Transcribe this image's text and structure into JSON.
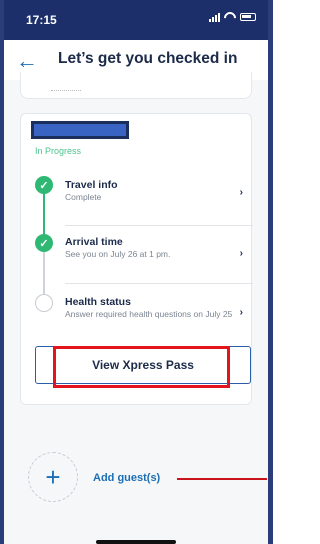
{
  "status_bar": {
    "time": "17:15"
  },
  "header": {
    "title": "Let’s get you checked in"
  },
  "checkin": {
    "status": "In Progress",
    "steps": [
      {
        "title": "Travel info",
        "subtitle": "Complete",
        "state": "complete"
      },
      {
        "title": "Arrival time",
        "subtitle": "See you on July 26 at 1 pm.",
        "state": "complete"
      },
      {
        "title": "Health status",
        "subtitle": "Answer required health questions on July 25",
        "state": "pending"
      }
    ],
    "xpress_button_label": "View Xpress Pass"
  },
  "guests": {
    "add_label": "Add guest(s)"
  },
  "colors": {
    "accent": "#1c6fb5",
    "complete": "#2eb873",
    "annotation": "#e3141b",
    "statusbar": "#1c2f6b"
  },
  "icons": {
    "back": "back-arrow-icon",
    "check": "checkmark-icon",
    "chevron": "chevron-right-icon",
    "plus": "plus-icon"
  }
}
